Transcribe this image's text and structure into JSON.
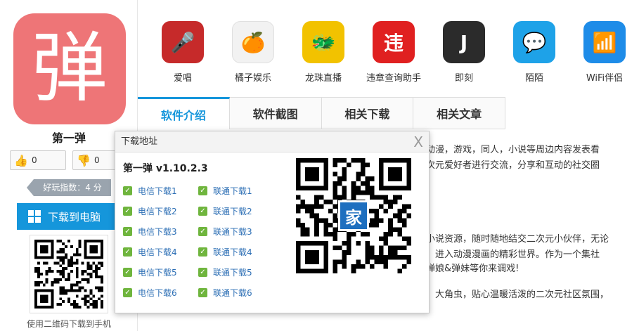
{
  "app": {
    "icon_glyph": "弹",
    "icon_color": "#ee7577",
    "name": "第一弹",
    "up_votes": "0",
    "down_votes": "0",
    "score_text": "好玩指数：4 分",
    "download_pc_label": "下载到电脑",
    "qr_caption": "使用二维码下载到手机"
  },
  "related_apps": [
    {
      "name": "爱唱",
      "glyph": "🎤",
      "color": "#c62a2a",
      "icon": "microphone-icon"
    },
    {
      "name": "橘子娱乐",
      "glyph": "🍊",
      "color": "#f2f2f2",
      "icon": "orange-icon"
    },
    {
      "name": "龙珠直播",
      "glyph": "🐲",
      "color": "#f2c200",
      "icon": "dragon-icon"
    },
    {
      "name": "违章查询助手",
      "glyph": "违",
      "color": "#e02020",
      "icon": "traffic-icon"
    },
    {
      "name": "即刻",
      "glyph": "J",
      "color": "#2b2b2b",
      "icon": "jike-icon"
    },
    {
      "name": "陌陌",
      "glyph": "💬",
      "color": "#1ea2e8",
      "icon": "momo-icon"
    },
    {
      "name": "WiFi伴侣",
      "glyph": "📶",
      "color": "#1e8ce8",
      "icon": "wifi-icon"
    }
  ],
  "tabs": [
    {
      "label": "软件介绍",
      "active": true
    },
    {
      "label": "软件截图",
      "active": false
    },
    {
      "label": "相关下载",
      "active": false
    },
    {
      "label": "相关文章",
      "active": false
    }
  ],
  "description": {
    "line1": "动漫，游戏，同人，小说等周边内容发表看",
    "line2": "次元爱好者进行交流，分享和互动的社交圈",
    "line3": "小说资源，随时随地结交二次元小伙伴，无论",
    "line4": "，进入动漫漫画的精彩世界。作为一个集社",
    "line5": "弹娘&弹妹等你来调戏!",
    "line6": "，大角虫，贴心温暖活泼的二次元社区氛围，"
  },
  "popup": {
    "header": "下载地址",
    "close_glyph": "X",
    "title": "第一弹 v1.10.2.3",
    "telecom_downloads": [
      "电信下载1",
      "电信下载2",
      "电信下载3",
      "电信下载4",
      "电信下载5",
      "电信下载6"
    ],
    "unicom_downloads": [
      "联通下载1",
      "联通下载2",
      "联通下载3",
      "联通下载4",
      "联通下载5",
      "联通下载6"
    ],
    "qr_logo_glyph": "家",
    "link_color": "#2d6fb5",
    "check_color": "#6fb53d"
  },
  "accent_color": "#1596db"
}
